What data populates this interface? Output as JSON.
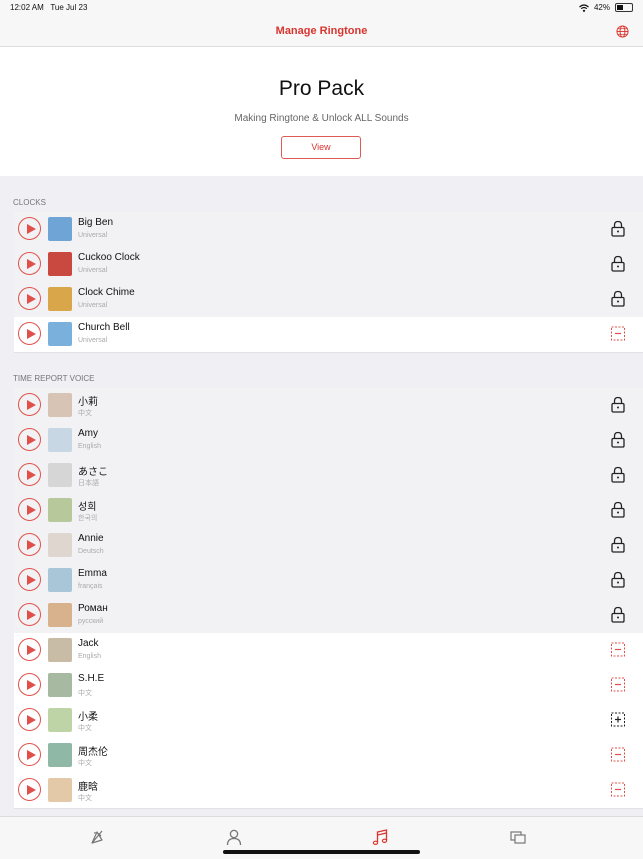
{
  "status_bar": {
    "time": "12:02 AM",
    "date": "Tue Jul 23",
    "battery": "42%",
    "battery_level": 0.42
  },
  "nav": {
    "title": "Manage Ringtone",
    "right_icon": "globe-icon"
  },
  "pro": {
    "title": "Pro Pack",
    "subtitle": "Making Ringtone & Unlock ALL Sounds",
    "button": "View"
  },
  "sections": [
    {
      "header": "CLOCKS",
      "items": [
        {
          "title": "Big Ben",
          "subtitle": "Universal",
          "state": "locked"
        },
        {
          "title": "Cuckoo Clock",
          "subtitle": "Universal",
          "state": "locked"
        },
        {
          "title": "Clock Chime",
          "subtitle": "Universal",
          "state": "locked"
        },
        {
          "title": "Church Bell",
          "subtitle": "Universal",
          "state": "remove"
        }
      ]
    },
    {
      "header": "TIME REPORT VOICE",
      "items": [
        {
          "title": "小莉",
          "subtitle": "中文",
          "state": "locked"
        },
        {
          "title": "Amy",
          "subtitle": "English",
          "state": "locked"
        },
        {
          "title": "あさこ",
          "subtitle": "日本語",
          "state": "locked"
        },
        {
          "title": "성희",
          "subtitle": "한국의",
          "state": "locked"
        },
        {
          "title": "Annie",
          "subtitle": "Deutsch",
          "state": "locked"
        },
        {
          "title": "Emma",
          "subtitle": "français",
          "state": "locked"
        },
        {
          "title": "Роман",
          "subtitle": "русский",
          "state": "locked"
        },
        {
          "title": "Jack",
          "subtitle": "English",
          "state": "remove"
        },
        {
          "title": "S.H.E",
          "subtitle": "中文",
          "state": "remove"
        },
        {
          "title": "小柔",
          "subtitle": "中文",
          "state": "add"
        },
        {
          "title": "周杰伦",
          "subtitle": "中文",
          "state": "remove"
        },
        {
          "title": "鹿晗",
          "subtitle": "中文",
          "state": "remove"
        }
      ]
    }
  ],
  "tabs": [
    {
      "icon": "bell-icon",
      "selected": false
    },
    {
      "icon": "person-icon",
      "selected": false
    },
    {
      "icon": "music-note-icon",
      "selected": true
    },
    {
      "icon": "overlap-squares-icon",
      "selected": false
    }
  ],
  "colors": {
    "accent": "#d9352f",
    "icon_gray": "#777777",
    "locked_row": "#f2f2f4",
    "unlocked_row": "#ffffff"
  }
}
